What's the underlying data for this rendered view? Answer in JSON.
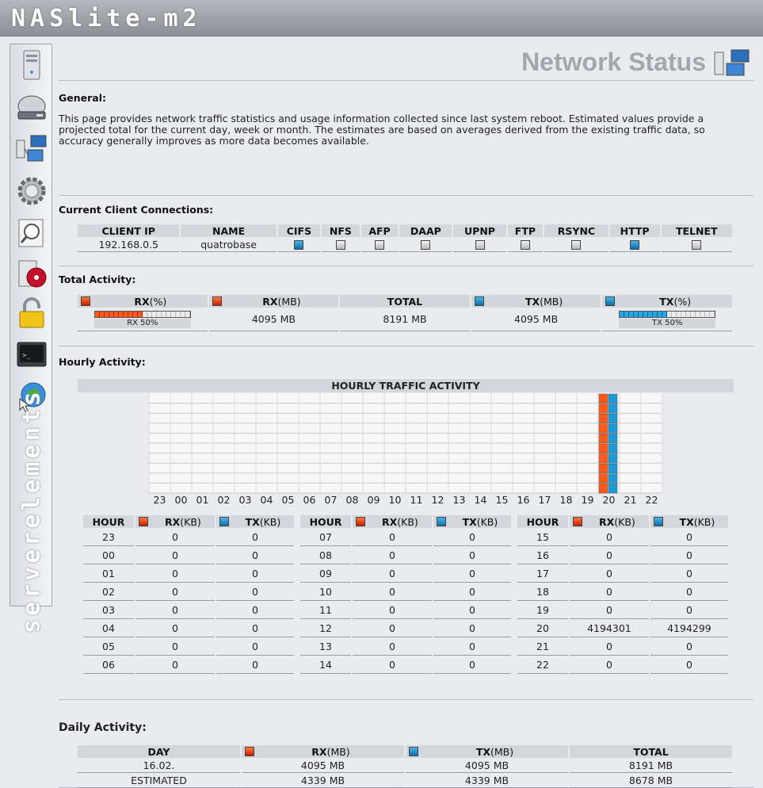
{
  "app": {
    "logo_text": "NASlite-m2"
  },
  "page": {
    "title": "Network Status"
  },
  "sidebar": {
    "items": [
      {
        "icon": "server-icon"
      },
      {
        "icon": "hard-drive-icon"
      },
      {
        "icon": "network-computers-icon"
      },
      {
        "icon": "gear-icon"
      },
      {
        "icon": "magnifier-icon"
      },
      {
        "icon": "cd-install-icon"
      },
      {
        "icon": "padlock-icon"
      },
      {
        "icon": "terminal-icon"
      },
      {
        "icon": "globe-cursor-icon"
      }
    ],
    "brand_text": "serverelements"
  },
  "general": {
    "heading": "General:",
    "description": "This page provides network traffic statistics and usage information collected since last system reboot. Estimated values provide a projected total for the current day, week or month. The estimates are based on averages derived from the existing traffic data, so accuracy generally improves as more data becomes available."
  },
  "connections": {
    "heading": "Current Client Connections:",
    "columns": [
      "CLIENT IP",
      "NAME",
      "CIFS",
      "NFS",
      "AFP",
      "DAAP",
      "UPNP",
      "FTP",
      "RSYNC",
      "HTTP",
      "TELNET"
    ],
    "rows": [
      {
        "ip": "192.168.0.5",
        "name": "quatrobase",
        "flags": [
          true,
          false,
          false,
          false,
          false,
          false,
          false,
          true,
          false
        ]
      }
    ]
  },
  "total": {
    "heading": "Total Activity:",
    "headers": {
      "rx_pct": "RX",
      "rx_pct_unit": "(%)",
      "rx_mb": "RX",
      "rx_mb_unit": "(MB)",
      "total": "TOTAL",
      "tx_mb": "TX",
      "tx_mb_unit": "(MB)",
      "tx_pct": "TX",
      "tx_pct_unit": "(%)"
    },
    "rx_percent": 50,
    "rx_bar_label": "RX 50%",
    "rx_mb": "4095 MB",
    "total_mb": "8191 MB",
    "tx_mb": "4095 MB",
    "tx_percent": 50,
    "tx_bar_label": "TX 50%"
  },
  "hourly": {
    "heading": "Hourly Activity:",
    "chart_title": "HOURLY TRAFFIC ACTIVITY",
    "table_headers": {
      "hour": "HOUR",
      "rx": "RX",
      "tx": "TX",
      "unit": "(KB)"
    }
  },
  "chart_data": {
    "type": "bar",
    "title": "HOURLY TRAFFIC ACTIVITY",
    "categories": [
      "23",
      "00",
      "01",
      "02",
      "03",
      "04",
      "05",
      "06",
      "07",
      "08",
      "09",
      "10",
      "11",
      "12",
      "13",
      "14",
      "15",
      "16",
      "17",
      "18",
      "19",
      "20",
      "21",
      "22"
    ],
    "series": [
      {
        "name": "RX",
        "values": [
          0,
          0,
          0,
          0,
          0,
          0,
          0,
          0,
          0,
          0,
          0,
          0,
          0,
          0,
          0,
          0,
          0,
          0,
          0,
          0,
          0,
          4194301,
          0,
          0
        ]
      },
      {
        "name": "TX",
        "values": [
          0,
          0,
          0,
          0,
          0,
          0,
          0,
          0,
          0,
          0,
          0,
          0,
          0,
          0,
          0,
          0,
          0,
          0,
          0,
          0,
          0,
          4194299,
          0,
          0
        ]
      }
    ],
    "ylim": [
      0,
      4194301
    ],
    "grid": true,
    "colors": {
      "rx": "#ff5a1a",
      "tx": "#1a9bd8"
    }
  },
  "daily": {
    "heading": "Daily Activity:",
    "headers": {
      "day": "DAY",
      "rx": "RX",
      "tx": "TX",
      "unit": "(MB)",
      "total": "TOTAL"
    },
    "rows": [
      {
        "day": "16.02.",
        "rx": "4095 MB",
        "tx": "4095 MB",
        "total": "8191 MB"
      },
      {
        "day": "ESTIMATED",
        "rx": "4339 MB",
        "tx": "4339 MB",
        "total": "8678 MB"
      }
    ]
  }
}
